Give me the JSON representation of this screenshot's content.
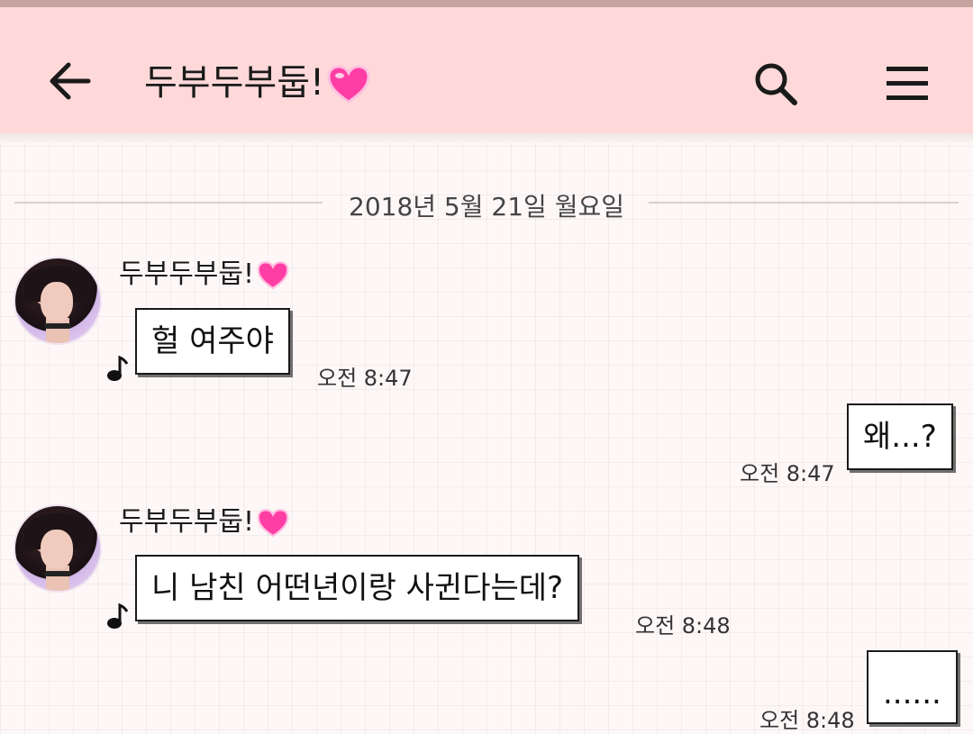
{
  "header": {
    "title": "두부두부둡!",
    "back_icon": "arrow-left-icon",
    "search_icon": "search-icon",
    "menu_icon": "hamburger-menu-icon",
    "heart_icon": "pink-heart-emoji",
    "background_color": "#ffd9d9"
  },
  "date_divider": "2018년 5월 21일 월요일",
  "messages": [
    {
      "side": "left",
      "sender": "두부두부둡!",
      "text": "헐 여주야",
      "time": "오전 8:47"
    },
    {
      "side": "right",
      "text": "왜...?",
      "time": "오전 8:47"
    },
    {
      "side": "left",
      "sender": "두부두부둡!",
      "text": "니 남친 어떤년이랑 사귄다는데?",
      "time": "오전 8:48"
    },
    {
      "side": "right",
      "text": "......",
      "time": "오전 8:48"
    }
  ]
}
